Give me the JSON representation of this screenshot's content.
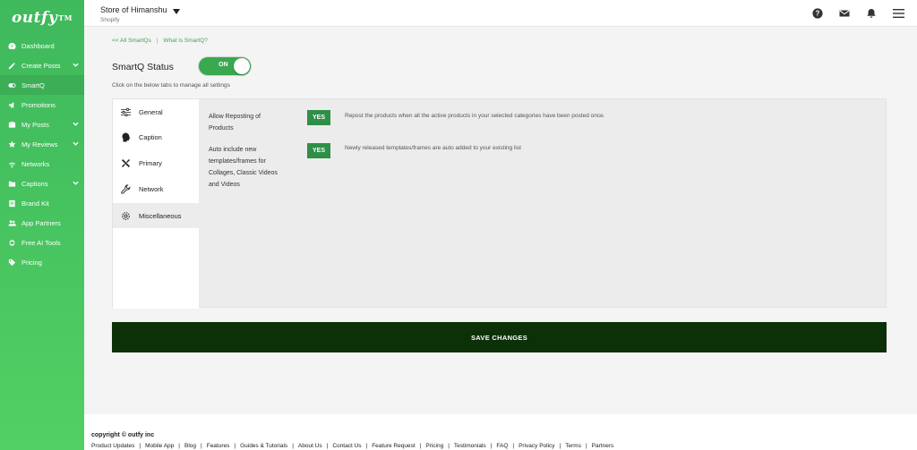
{
  "brand": {
    "logo_text": "outfy",
    "logo_tm": "TM"
  },
  "sidebar": {
    "items": [
      {
        "label": "Dashboard",
        "icon": "dashboard-icon",
        "chevron": false
      },
      {
        "label": "Create Posts",
        "icon": "pencil-icon",
        "chevron": true
      },
      {
        "label": "SmartQ",
        "icon": "toggle-icon",
        "chevron": false,
        "active": true
      },
      {
        "label": "Promotions",
        "icon": "megaphone-icon",
        "chevron": false
      },
      {
        "label": "My Posts",
        "icon": "briefcase-icon",
        "chevron": true
      },
      {
        "label": "My Reviews",
        "icon": "star-icon",
        "chevron": true
      },
      {
        "label": "Networks",
        "icon": "wifi-icon",
        "chevron": false
      },
      {
        "label": "Captions",
        "icon": "folder-icon",
        "chevron": true
      },
      {
        "label": "Brand Kit",
        "icon": "brand-kit-icon",
        "chevron": false
      },
      {
        "label": "App Partners",
        "icon": "users-icon",
        "chevron": false
      },
      {
        "label": "Free AI Tools",
        "icon": "ai-icon",
        "chevron": false
      },
      {
        "label": "Pricing",
        "icon": "tag-icon",
        "chevron": false
      }
    ]
  },
  "header": {
    "store_name": "Store of Himanshu",
    "platform": "Shopify",
    "icons": [
      "help-icon",
      "mail-icon",
      "bell-icon",
      "menu-icon"
    ]
  },
  "breadcrumbs": {
    "all": "<< All SmartQs",
    "separator": "|",
    "what": "What is SmartQ?"
  },
  "status": {
    "label": "SmartQ Status",
    "toggle_text": "ON",
    "hint": "Click on the below tabs to manage all settings"
  },
  "tabs": [
    {
      "label": "General",
      "icon": "sliders-icon"
    },
    {
      "label": "Caption",
      "icon": "head-icon"
    },
    {
      "label": "Primary",
      "icon": "tools-icon"
    },
    {
      "label": "Network",
      "icon": "wrench-icon"
    },
    {
      "label": "Miscellaneous",
      "icon": "gear-icon",
      "active": true
    }
  ],
  "options": [
    {
      "label_lines": [
        "Allow Reposting of",
        "Products"
      ],
      "value": "YES",
      "description": "Repost the products when all the active products in your selected categories have been posted once."
    },
    {
      "label_lines": [
        "Auto include new",
        "templates/frames for",
        "Collages, Classic Videos",
        "and Videos"
      ],
      "value": "YES",
      "description": "Newly released templates/frames are auto added to your existing list"
    }
  ],
  "save_button": "SAVE CHANGES",
  "footer": {
    "copyright": "copyright © outfy inc",
    "separator": "|",
    "links": [
      "Product Updates",
      "Mobile App",
      "Blog",
      "Features",
      "Guides & Tutorials",
      "About Us",
      "Contact Us",
      "Feature Request",
      "Pricing",
      "Testimonials",
      "FAQ",
      "Privacy Policy",
      "Terms",
      "Partners"
    ]
  },
  "colors": {
    "sidebar_green": "#45c15f",
    "accent_green": "#3aa84f",
    "save_dark": "#0c3007"
  }
}
